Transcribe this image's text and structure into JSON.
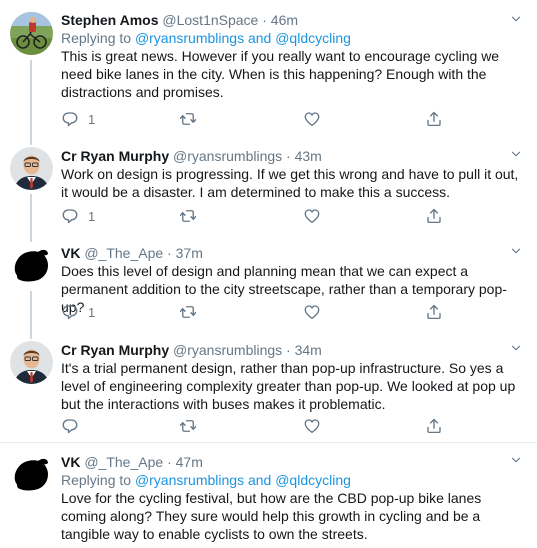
{
  "tweets": [
    {
      "name": "Stephen Amos",
      "handle": "@Lost1nSpace",
      "dot": "·",
      "time": "46m",
      "reply_prefix": "Replying to",
      "reply_mention1": "@ryansrumblings",
      "reply_and": "and",
      "reply_mention2": "@qldcycling",
      "text": "This is great news. However if you really want to encourage cycling we need bike lanes in the city. When is this happening? Enough with the distractions and promises.",
      "reply_count": "1",
      "avatar_icon": "cyclist-photo"
    },
    {
      "name": "Cr Ryan Murphy",
      "handle": "@ryansrumblings",
      "dot": "·",
      "time": "43m",
      "text": "Work on design is progressing. If we get this wrong and have to pull it out, it would be a disaster. I am determined to make this a success.",
      "reply_count": "1",
      "avatar_icon": "man-in-suit-photo"
    },
    {
      "name": "VK",
      "handle": "@_The_Ape",
      "dot": "·",
      "time": "37m",
      "text": "Does this level of design and planning mean that we can expect a permanent addition to the city streetscape, rather than a temporary pop-up?",
      "reply_count": "1",
      "avatar_icon": "black-blob-avatar"
    },
    {
      "name": "Cr Ryan Murphy",
      "handle": "@ryansrumblings",
      "dot": "·",
      "time": "34m",
      "text": "It's a trial permanent design, rather than pop-up infrastructure. So yes a level of engineering complexity greater than pop-up. We looked at pop up but the interactions with buses makes it problematic.",
      "reply_count": "",
      "avatar_icon": "man-in-suit-photo"
    },
    {
      "name": "VK",
      "handle": "@_The_Ape",
      "dot": "·",
      "time": "47m",
      "reply_prefix": "Replying to",
      "reply_mention1": "@ryansrumblings",
      "reply_and": "and",
      "reply_mention2": "@qldcycling",
      "text": "Love for the cycling festival, but how are the CBD pop-up bike lanes coming along? They sure would help this growth in cycling and be a tangible way to enable cyclists to own the streets.",
      "avatar_icon": "black-blob-avatar"
    }
  ],
  "colors": {
    "link": "#1b95e0",
    "secondary": "#657786",
    "thread_line": "#ccd6dd",
    "divider": "#e6ecf0"
  },
  "icons": [
    "reply-icon",
    "retweet-icon",
    "like-icon",
    "share-icon",
    "chevron-down-icon"
  ]
}
